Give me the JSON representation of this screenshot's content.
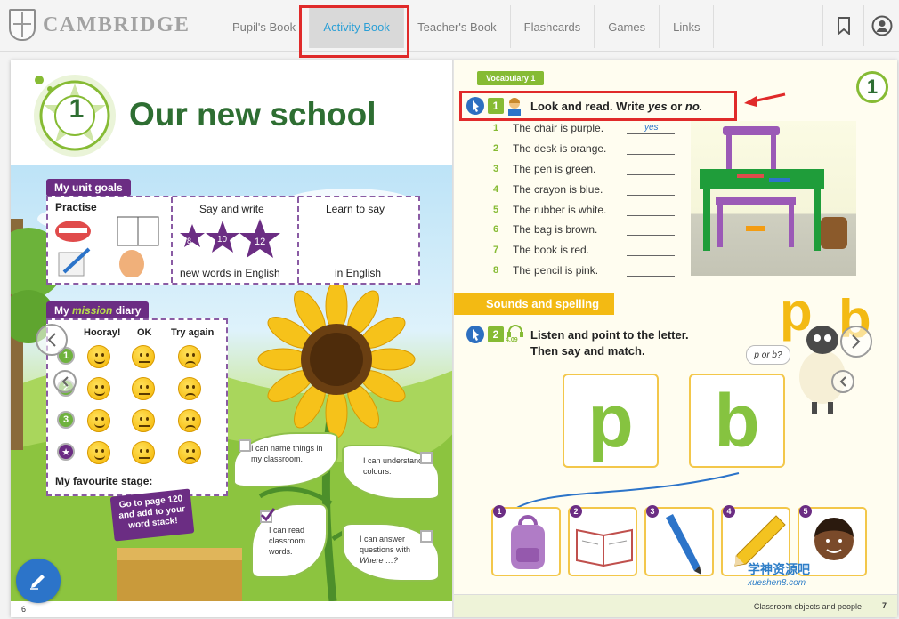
{
  "header": {
    "brand": "CAMBRIDGE",
    "tabs": [
      {
        "label": "Pupil's Book",
        "active": false
      },
      {
        "label": "Activity Book",
        "active": true
      },
      {
        "label": "Teacher's Book",
        "active": false
      },
      {
        "label": "Flashcards",
        "active": false
      },
      {
        "label": "Games",
        "active": false
      },
      {
        "label": "Links",
        "active": false
      }
    ],
    "icons": [
      "bookmark-icon",
      "user-icon"
    ]
  },
  "left_page": {
    "unit_number": "1",
    "title": "Our new school",
    "unit_goals": {
      "label": "My unit goals",
      "practise": "Practise",
      "say_and_write": "Say and write",
      "star_numbers": [
        "8",
        "10",
        "12"
      ],
      "new_words": "new words in English",
      "learn_to_say": "Learn to say",
      "in_english": "in English"
    },
    "diary": {
      "label_my": "My",
      "label_mission": "mission",
      "label_diary": "diary",
      "columns": [
        "Hooray!",
        "OK",
        "Try again"
      ],
      "stages": [
        "1",
        "2",
        "3",
        "★"
      ],
      "favourite_stage": "My favourite stage:"
    },
    "sign": "Go to page 120 and add to your word stack!",
    "leaves": [
      {
        "text": "I can name things in my classroom.",
        "checked": false
      },
      {
        "text": "I can understand colours.",
        "checked": false
      },
      {
        "text": "I can read classroom words.",
        "checked": true
      },
      {
        "text": "I can answer questions with",
        "italic": "Where …?",
        "checked": false
      }
    ],
    "page_number": "6"
  },
  "right_page": {
    "vocabulary_tag": "Vocabulary 1",
    "unit_badge": "1",
    "exercise1": {
      "number": "1",
      "instruction_start": "Look and read. Write",
      "yes": "yes",
      "or": "or",
      "no": "no.",
      "items": [
        {
          "num": "1",
          "text": "The chair is purple.",
          "answer": "yes"
        },
        {
          "num": "2",
          "text": "The desk is orange.",
          "answer": ""
        },
        {
          "num": "3",
          "text": "The pen is green.",
          "answer": ""
        },
        {
          "num": "4",
          "text": "The crayon is blue.",
          "answer": ""
        },
        {
          "num": "5",
          "text": "The rubber is white.",
          "answer": ""
        },
        {
          "num": "6",
          "text": "The bag is brown.",
          "answer": ""
        },
        {
          "num": "7",
          "text": "The book is red.",
          "answer": ""
        },
        {
          "num": "8",
          "text": "The pencil is pink.",
          "answer": ""
        }
      ]
    },
    "sounds_tag": "Sounds and spelling",
    "exercise2": {
      "number": "2",
      "audio_track": "4.09",
      "line1": "Listen and point to the letter.",
      "line2": "Then say and match."
    },
    "letters": [
      "p",
      "b"
    ],
    "big_letters": [
      "p",
      "b"
    ],
    "speech_bubble": "p or b?",
    "pictures": [
      {
        "num": "1",
        "icon": "backpack-icon"
      },
      {
        "num": "2",
        "icon": "book-icon"
      },
      {
        "num": "3",
        "icon": "pen-icon"
      },
      {
        "num": "4",
        "icon": "pencil-icon"
      },
      {
        "num": "5",
        "icon": "boy-icon"
      }
    ],
    "footer": "Classroom objects and people",
    "page_number": "7"
  },
  "watermark": {
    "line1": "学神资源吧",
    "line2": "xueshen8.com"
  },
  "colors": {
    "accent_blue": "#2a9fd6",
    "highlight_red": "#e02a2a",
    "unit_green": "#2e6e32",
    "purple": "#6b2d83",
    "yellow": "#f3ba13"
  }
}
